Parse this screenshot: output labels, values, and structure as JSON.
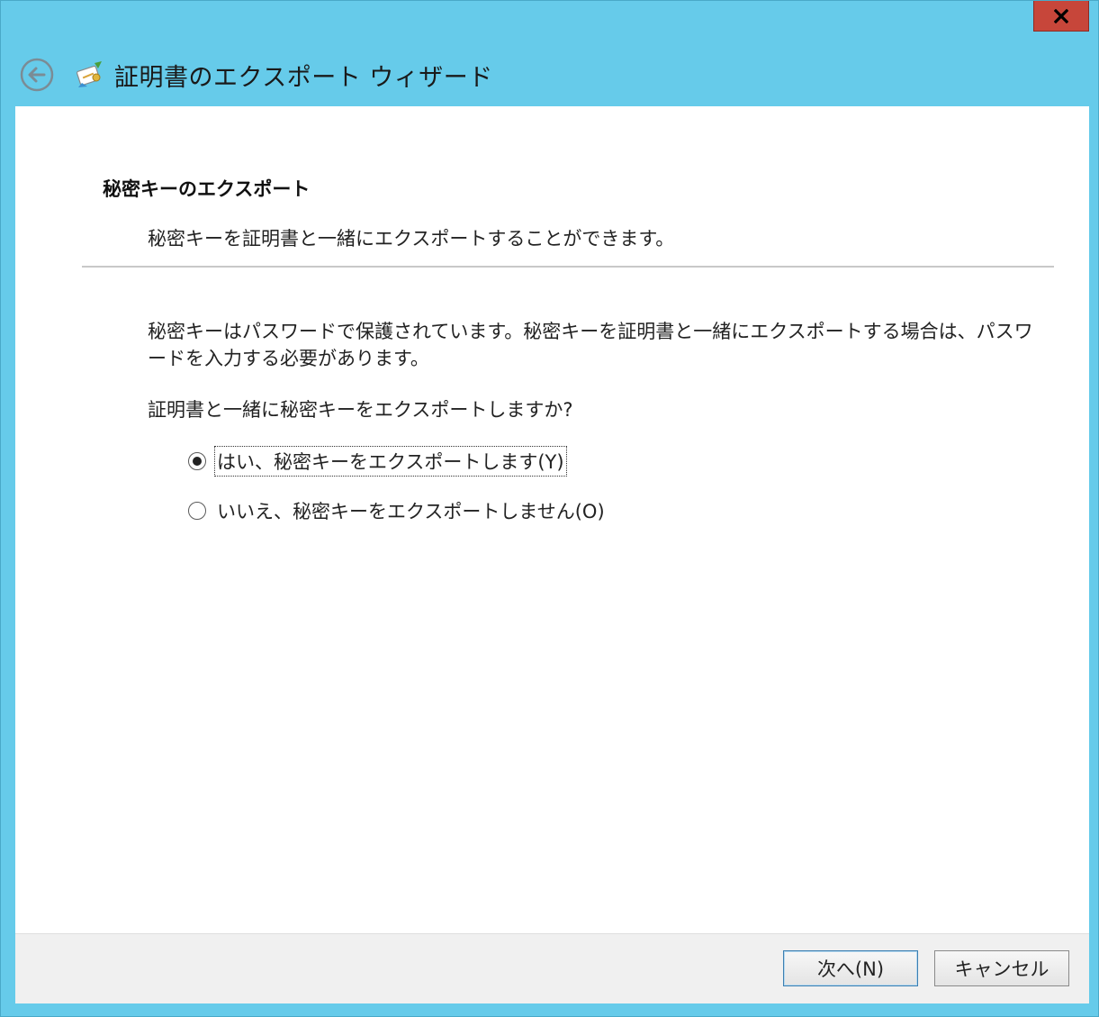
{
  "window": {
    "title": "証明書のエクスポート ウィザード",
    "close_label": "X",
    "accent_color": "#66cbea"
  },
  "icons": {
    "back": "back-arrow-icon",
    "wizard": "certificate-wizard-icon",
    "close": "close-icon"
  },
  "page": {
    "heading": "秘密キーのエクスポート",
    "description": "秘密キーを証明書と一緒にエクスポートすることができます。",
    "info": "秘密キーはパスワードで保護されています。秘密キーを証明書と一緒にエクスポートする場合は、パスワードを入力する必要があります。",
    "question": "証明書と一緒に秘密キーをエクスポートしますか?"
  },
  "options": {
    "yes_label": "はい、秘密キーをエクスポートします(Y)",
    "no_label": "いいえ、秘密キーをエクスポートしません(O)",
    "selected": "yes"
  },
  "buttons": {
    "next_label": "次へ(N)",
    "cancel_label": "キャンセル"
  }
}
